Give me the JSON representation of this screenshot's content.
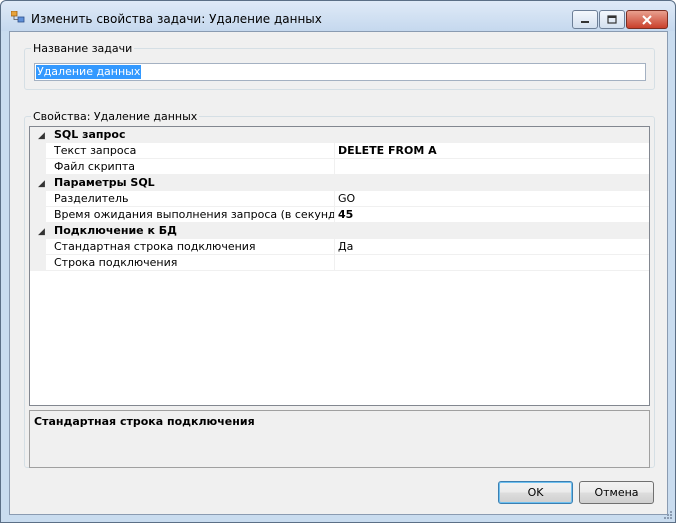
{
  "window": {
    "title": "Изменить свойства задачи: Удаление данных",
    "icon": "app-icon"
  },
  "task_name_group": {
    "legend": "Название задачи",
    "value": "Удаление данных"
  },
  "properties_group": {
    "legend": "Свойства: Удаление данных",
    "categories": [
      {
        "label": "SQL запрос",
        "props": [
          {
            "name": "Текст запроса",
            "value": "DELETE FROM A",
            "bold": true
          },
          {
            "name": "Файл скрипта",
            "value": "",
            "bold": false
          }
        ]
      },
      {
        "label": "Параметры SQL",
        "props": [
          {
            "name": "Разделитель",
            "value": "GO",
            "bold": false
          },
          {
            "name": "Время ожидания выполнения запроса (в секундах)",
            "value": "45",
            "bold": true
          }
        ]
      },
      {
        "label": "Подключение к БД",
        "props": [
          {
            "name": "Стандартная строка подключения",
            "value": "Да",
            "bold": false
          },
          {
            "name": "Строка подключения",
            "value": "",
            "bold": false
          }
        ]
      }
    ],
    "description_title": "Стандартная строка подключения"
  },
  "buttons": {
    "ok": "OK",
    "cancel": "Отмена"
  },
  "colors": {
    "title_bar": "#c5d8ee",
    "close_button": "#c9402c",
    "selection": "#3399ff",
    "dialog_bg": "#f0f0f0"
  }
}
